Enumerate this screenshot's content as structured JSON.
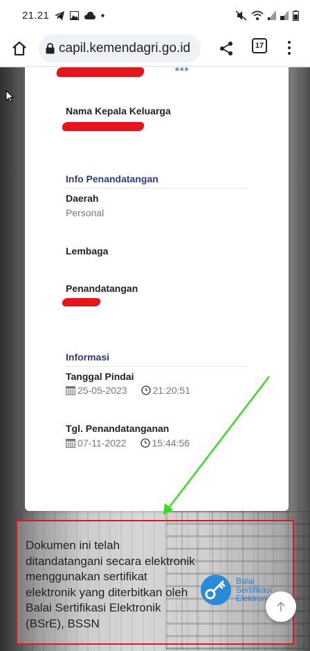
{
  "statusbar": {
    "time": "21.21"
  },
  "browser": {
    "url": "capil.kemendagri.go.id",
    "tab_count": "17"
  },
  "card": {
    "stars": "***",
    "head_of_family_label": "Nama Kepala Keluarga",
    "signing_info_title": "Info Penandatangan",
    "region_label": "Daerah",
    "region_value": "Personal",
    "institution_label": "Lembaga",
    "signer_label": "Penandatangan",
    "information_title": "Informasi",
    "scan_date_label": "Tanggal Pindai",
    "scan_date": "25-05-2023",
    "scan_time": "21:20:51",
    "sign_date_label": "Tgl. Penandatanganan",
    "sign_date": "07-11-2022",
    "sign_time": "15:44:56"
  },
  "banner": {
    "text": "Dokumen ini telah ditandatangani secara elektronik menggunakan sertifikat elektronik yang diterbitkan oleh Balai Sertifikasi Elektronik (BSrE), BSSN",
    "logo_line1": "Balai",
    "logo_line2": "Sertifikasi",
    "logo_line3": "Elektronik"
  },
  "colors": {
    "annotation_box": "#e0151b",
    "annotation_arrow": "#33e01a",
    "section_title": "#2e3a7a",
    "redaction": "#e8141b"
  }
}
